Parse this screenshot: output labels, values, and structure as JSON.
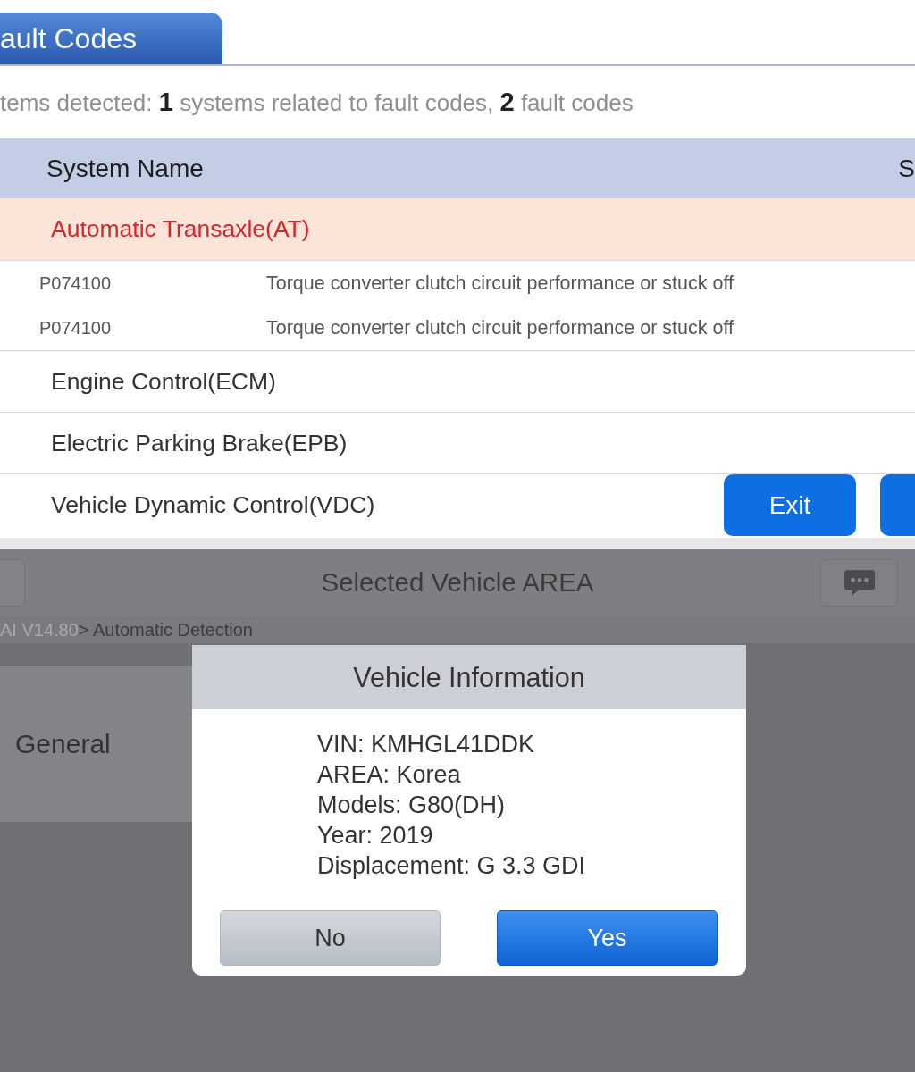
{
  "fault_panel": {
    "tab": {
      "label": "ault Codes",
      "selected": true
    },
    "summary": "tems detected: **1** systems related to fault codes, **2** fault codes",
    "table": {
      "columns": [
        "System Name",
        "S"
      ],
      "rows": [
        {
          "name": "Automatic Transaxle(AT)",
          "faulty": true,
          "faults": [
            {
              "code": "P074100",
              "description": "Torque converter clutch circuit performance or stuck off"
            },
            {
              "code": "P074100",
              "description": "Torque converter clutch circuit performance or stuck off"
            }
          ]
        },
        {
          "name": "Engine Control(ECM)",
          "faulty": false
        },
        {
          "name": "Electric Parking Brake(EPB)",
          "faulty": false
        },
        {
          "name": "Vehicle Dynamic Control(VDC)",
          "faulty": false
        }
      ]
    },
    "buttons": [
      {
        "kind": "labeled",
        "label": "Exit"
      },
      {
        "kind": "cut_off"
      }
    ]
  },
  "vehicle_screen": {
    "title": "Selected Vehicle AREA",
    "breadcrumb": [
      {
        "kind": "link",
        "text": "AI V14.80"
      },
      {
        "kind": "current",
        "text": "> Automatic Detection"
      }
    ],
    "menu_items": [
      {
        "label": "General"
      }
    ],
    "dialog": {
      "title": "Vehicle Information",
      "lines": [
        "VIN: KMHGL41DDK",
        "AREA: Korea",
        "Models: G80(DH)",
        "Year: 2019",
        "Displacement: G 3.3 GDI"
      ],
      "buttons": [
        {
          "kind": "secondary",
          "label": "No"
        },
        {
          "kind": "primary",
          "label": "Yes"
        }
      ]
    }
  }
}
